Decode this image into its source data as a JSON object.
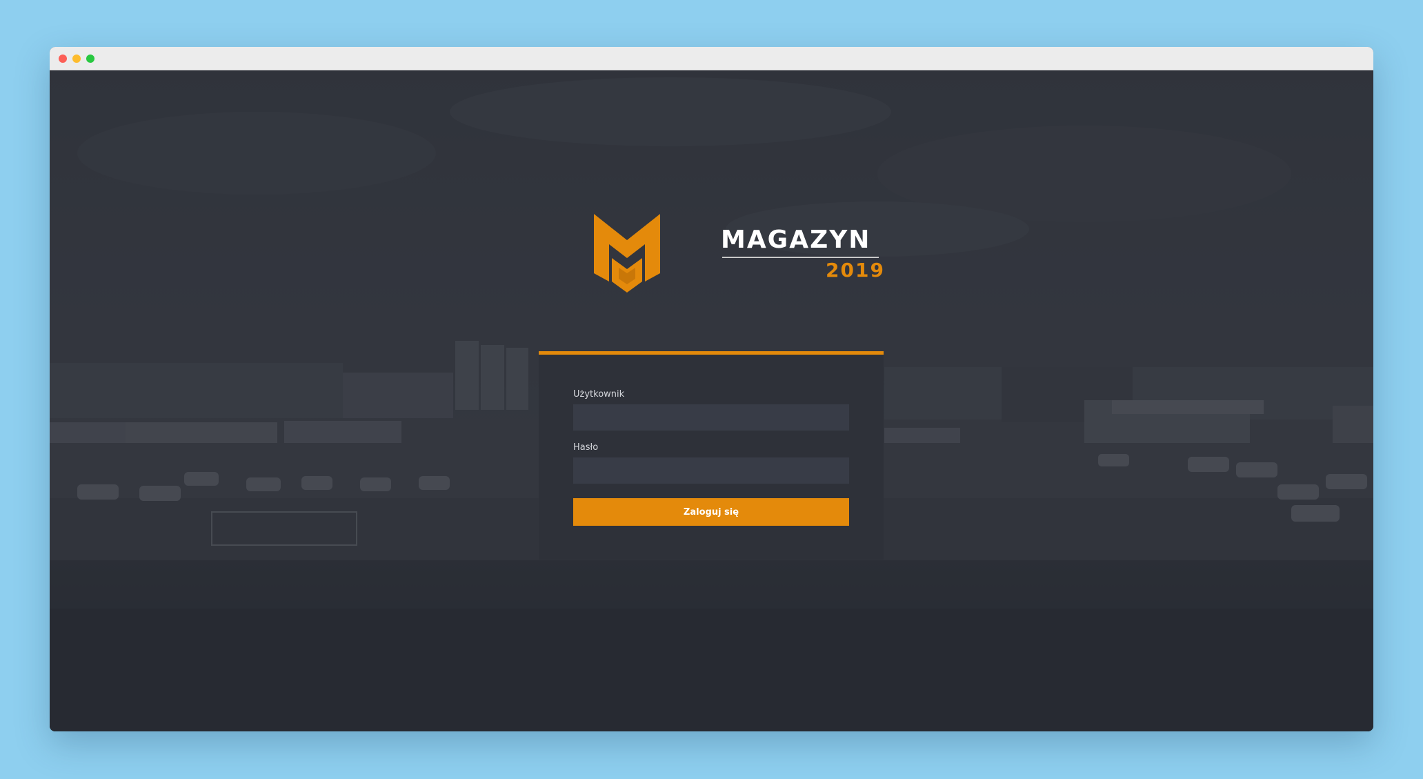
{
  "window": {
    "controls": [
      "close",
      "minimize",
      "maximize"
    ]
  },
  "brand": {
    "name": "MAGAZYN",
    "year": "2019",
    "logo_icon": "m-shield-logo-icon",
    "accent_color": "#e48a0b"
  },
  "login_form": {
    "username_label": "Użytkownik",
    "username_value": "",
    "password_label": "Hasło",
    "password_value": "",
    "submit_label": "Zaloguj się"
  },
  "colors": {
    "page_background": "#8ecfef",
    "card_background": "#2e3139",
    "input_background": "#383c47",
    "button": "#e48a0b"
  }
}
